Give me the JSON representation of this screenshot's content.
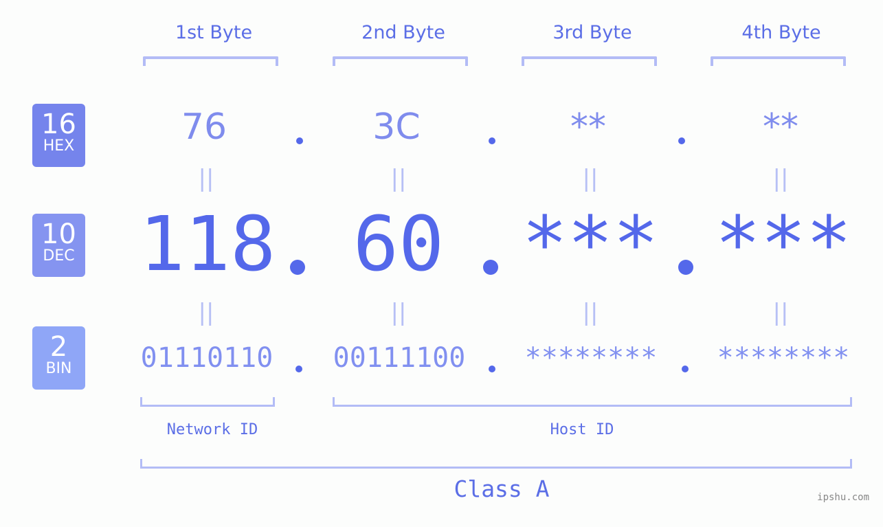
{
  "bytes": [
    {
      "title": "1st Byte",
      "hex": "76",
      "dec": "118",
      "bin": "01110110"
    },
    {
      "title": "2nd Byte",
      "hex": "3C",
      "dec": "60",
      "bin": "00111100"
    },
    {
      "title": "3rd Byte",
      "hex": "**",
      "dec": "***",
      "bin": "********"
    },
    {
      "title": "4th Byte",
      "hex": "**",
      "dec": "***",
      "bin": "********"
    }
  ],
  "bases": {
    "hex": {
      "num": "16",
      "label": "HEX",
      "color": "#7584ec"
    },
    "dec": {
      "num": "10",
      "label": "DEC",
      "color": "#8594f0"
    },
    "bin": {
      "num": "2",
      "label": "BIN",
      "color": "#8fa6f7"
    }
  },
  "separator": ".",
  "equals": "=",
  "segments": {
    "network": "Network ID",
    "host": "Host ID",
    "class": "Class A"
  },
  "watermark": "ipshu.com",
  "colors": {
    "accent": "#5468ea",
    "bracket": "#b3bcf6",
    "hex_text": "#7f8ced",
    "bin_text": "#8190f0"
  }
}
